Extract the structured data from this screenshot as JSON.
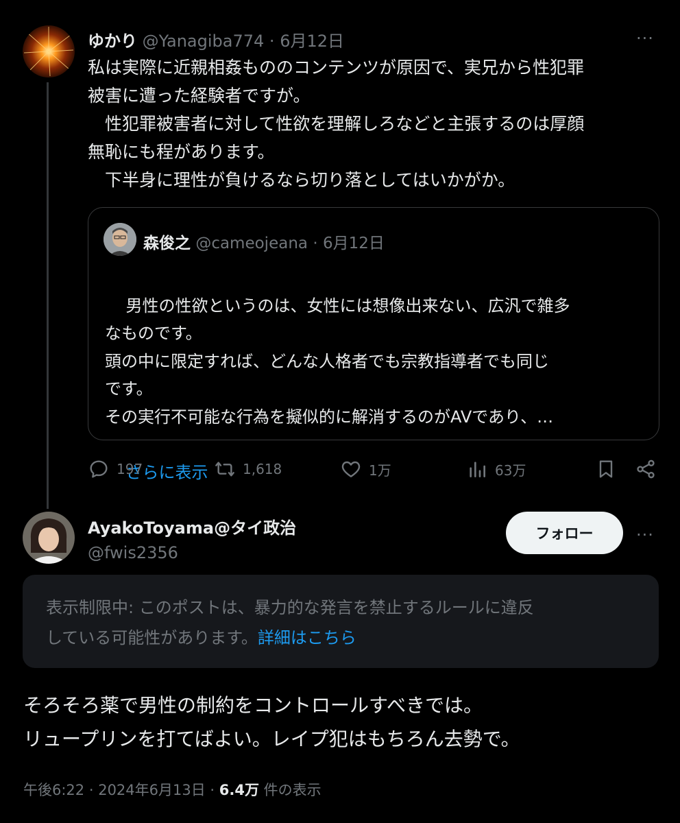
{
  "tweet": {
    "author_name": "ゆかり",
    "handle": "@Yanagiba774",
    "separator": "·",
    "date": "6月12日",
    "more": "···",
    "text": "私は実際に近親相姦もののコンテンツが原因で、実兄から性犯罪\n被害に遭った経験者ですが。\n　性犯罪被害者に対して性欲を理解しろなどと主張するのは厚顔\n無恥にも程があります。\n　下半身に理性が負けるなら切り落としてはいかがか。"
  },
  "quoted": {
    "author_name": "森俊之",
    "handle": "@cameojeana",
    "separator": "·",
    "date": "6月12日",
    "text": "男性の性欲というのは、女性には想像出来ない、広汎で雑多\nなものです。\n頭の中に限定すれば、どんな人格者でも宗教指導者でも同じ\nです。\nその実行不可能な行為を擬似的に解消するのがAVであり、…",
    "show_more": "さらに表示"
  },
  "actions": {
    "replies": "197",
    "retweets": "1,618",
    "likes": "1万",
    "views": "63万"
  },
  "reply": {
    "author_name": "AyakoToyama@タイ政治",
    "handle": "@fwis2356",
    "follow_label": "フォロー",
    "more": "···",
    "notice_text": "表示制限中: このポストは、暴力的な発言を禁止するルールに違反\nしている可能性があります。",
    "notice_link": "詳細はこちら",
    "text": "そろそろ薬で男性の制約をコントロールすべきでは。\nリュープリンを打てばよい。レイプ犯はもちろん去勢で。",
    "time": "午後6:22",
    "sep1": " · ",
    "date": "2024年6月13日",
    "sep2": " · ",
    "views_count": "6.4万",
    "views_label": " 件の表示"
  },
  "colors": {
    "background": "#000000",
    "text": "#e7e9ea",
    "muted": "#71767b",
    "link": "#1d9bf0",
    "border": "#38393b",
    "notice_bg": "#16181c"
  }
}
